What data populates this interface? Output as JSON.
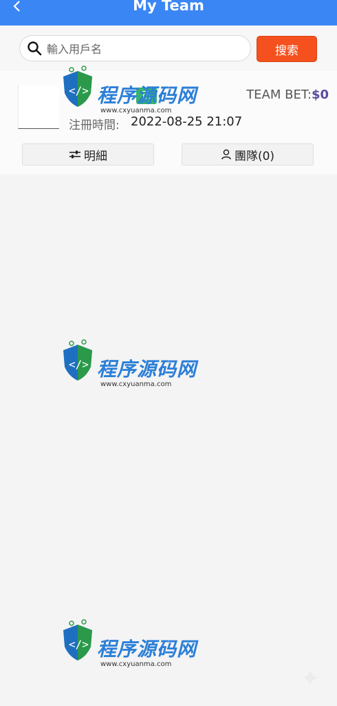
{
  "header": {
    "title": "My Team",
    "back_icon": "chevron-left-icon",
    "background": "#3b86f5"
  },
  "search": {
    "placeholder": "輸入用戶名",
    "button_label": "搜索",
    "icon": "search-icon",
    "button_color": "#f4511e"
  },
  "member": {
    "username": "",
    "status": "已",
    "team_bet_label": "TEAM BET:",
    "team_bet_value": "$0",
    "reg_label": "注冊時間:",
    "reg_value": "2022-08-25 21:07",
    "detail_button": "明細",
    "team_button": "團隊(0)",
    "detail_icon": "sliders-icon",
    "team_icon": "person-icon"
  },
  "watermark": {
    "brand": "程序源码网",
    "url": "www.cxyuanma.com"
  }
}
